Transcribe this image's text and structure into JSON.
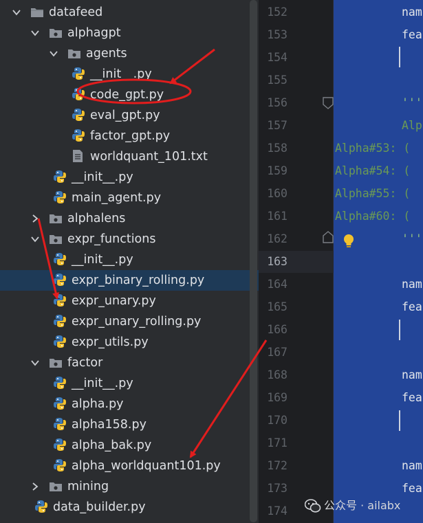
{
  "tree": {
    "items": [
      {
        "label": "datafeed",
        "type": "folder",
        "expanded": true
      },
      {
        "label": "alphagpt",
        "type": "package",
        "expanded": true
      },
      {
        "label": "agents",
        "type": "package",
        "expanded": true
      },
      {
        "label": "__init__.py",
        "type": "python"
      },
      {
        "label": "code_gpt.py",
        "type": "python"
      },
      {
        "label": "eval_gpt.py",
        "type": "python"
      },
      {
        "label": "factor_gpt.py",
        "type": "python"
      },
      {
        "label": "worldquant_101.txt",
        "type": "text"
      },
      {
        "label": "__init__.py",
        "type": "python"
      },
      {
        "label": "main_agent.py",
        "type": "python"
      },
      {
        "label": "alphalens",
        "type": "package",
        "expanded": false
      },
      {
        "label": "expr_functions",
        "type": "package",
        "expanded": true
      },
      {
        "label": "__init__.py",
        "type": "python"
      },
      {
        "label": "expr_binary_rolling.py",
        "type": "python",
        "selected": true
      },
      {
        "label": "expr_unary.py",
        "type": "python"
      },
      {
        "label": "expr_unary_rolling.py",
        "type": "python"
      },
      {
        "label": "expr_utils.py",
        "type": "python"
      },
      {
        "label": "factor",
        "type": "package",
        "expanded": true
      },
      {
        "label": "__init__.py",
        "type": "python"
      },
      {
        "label": "alpha.py",
        "type": "python"
      },
      {
        "label": "alpha158.py",
        "type": "python"
      },
      {
        "label": "alpha_bak.py",
        "type": "python"
      },
      {
        "label": "alpha_worldquant101.py",
        "type": "python"
      },
      {
        "label": "mining",
        "type": "package",
        "expanded": false
      },
      {
        "label": "data_builder.py",
        "type": "python"
      }
    ]
  },
  "gutter": {
    "line_numbers": [
      "152",
      "153",
      "154",
      "155",
      "156",
      "157",
      "158",
      "159",
      "160",
      "161",
      "162",
      "163",
      "164",
      "165",
      "166",
      "167",
      "168",
      "169",
      "170",
      "171",
      "172",
      "173",
      "174"
    ],
    "current_line": "163"
  },
  "editor": {
    "lines": {
      "152": "nam",
      "153": "fea",
      "156": "'''",
      "157": "Alp",
      "162": "'''",
      "164": "nam",
      "165": "fea",
      "168": "nam",
      "169": "fea",
      "172": "nam",
      "173": "fea"
    },
    "overflow_lines": {
      "158": "Alpha#53: (",
      "159": "Alpha#54: (",
      "160": "Alpha#55: (",
      "161": "Alpha#60: ("
    }
  },
  "watermark": {
    "text": "公众号 · ailabx"
  },
  "colors": {
    "annotation_red": "#e11d1d",
    "selection": "#1e3a57",
    "editor_selection": "#234598",
    "docstring_green": "#6a9955"
  }
}
